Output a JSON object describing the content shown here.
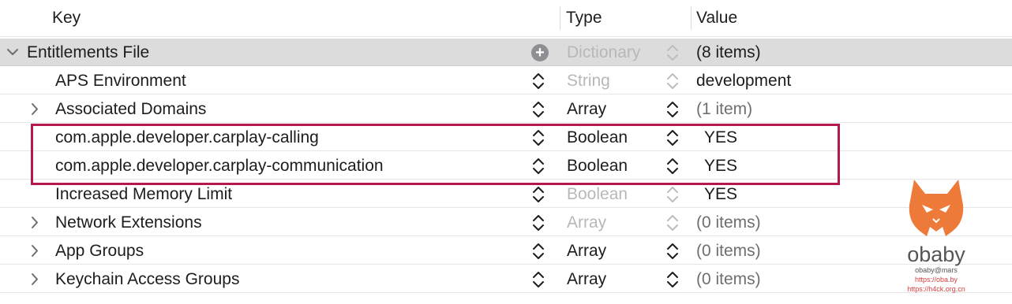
{
  "header": {
    "key_label": "Key",
    "type_label": "Type",
    "value_label": "Value"
  },
  "rows": [
    {
      "key": "Entitlements File",
      "type": "Dictionary",
      "value": "(8 items)",
      "type_dimmed": true,
      "expanded": true,
      "root": true
    },
    {
      "key": "APS Environment",
      "type": "String",
      "value": "development",
      "type_dimmed": true
    },
    {
      "key": "Associated Domains",
      "type": "Array",
      "value": "(1 item)",
      "expandable": true,
      "value_dimmed": true
    },
    {
      "key": "com.apple.developer.carplay-calling",
      "type": "Boolean",
      "value": "YES",
      "highlighted": true
    },
    {
      "key": "com.apple.developer.carplay-communication",
      "type": "Boolean",
      "value": "YES",
      "highlighted": true
    },
    {
      "key": "Increased Memory Limit",
      "type": "Boolean",
      "value": "YES",
      "type_dimmed": true
    },
    {
      "key": "Network Extensions",
      "type": "Array",
      "value": "(0 items)",
      "expandable": true,
      "type_dimmed": true,
      "value_dimmed": true
    },
    {
      "key": "App Groups",
      "type": "Array",
      "value": "(0 items)",
      "expandable": true,
      "value_dimmed": true
    },
    {
      "key": "Keychain Access Groups",
      "type": "Array",
      "value": "(0 items)",
      "expandable": true,
      "value_dimmed": true
    }
  ],
  "watermark": {
    "name": "obaby",
    "tag": "obaby@mars",
    "url1": "https://oba.by",
    "url2": "https://h4ck.org.cn"
  },
  "colors": {
    "highlight_border": "#b5174f",
    "root_row_bg": "#dcdcdc",
    "dimmed_text": "#b8b8b8",
    "watermark_accent": "#ee7a3a"
  },
  "icons": {
    "add": "plus-circle-icon",
    "stepper": "up-down-chevron-icon",
    "disclosure_collapsed": "chevron-right-icon",
    "disclosure_expanded": "chevron-down-icon"
  }
}
